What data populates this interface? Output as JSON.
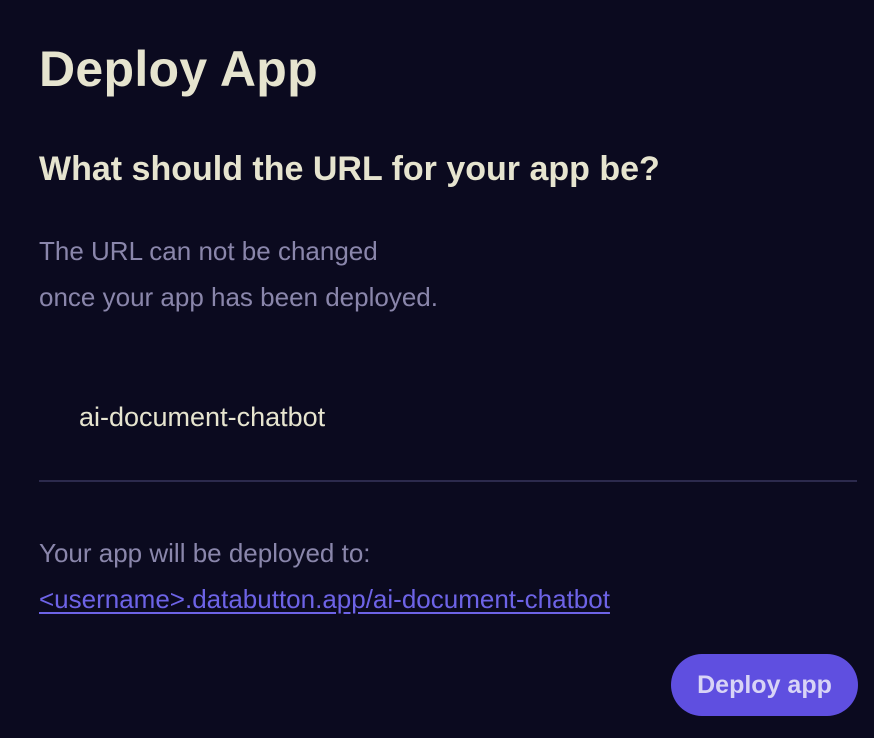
{
  "dialog": {
    "title": "Deploy App",
    "question": "What should the URL for your app be?",
    "note_line1": "The URL can not be changed",
    "note_line2": "once your app has been deployed.",
    "url_input": {
      "value": "ai-document-chatbot"
    },
    "deploy_info": {
      "label": "Your app will be deployed to:",
      "link": "<username>.databutton.app/ai-document-chatbot"
    },
    "deploy_button_label": "Deploy app"
  },
  "colors": {
    "background": "#0b0a1f",
    "text": "#e6e4cf",
    "muted": "#8a86ab",
    "accent": "#5f4fe0",
    "link": "#6d63e6"
  }
}
